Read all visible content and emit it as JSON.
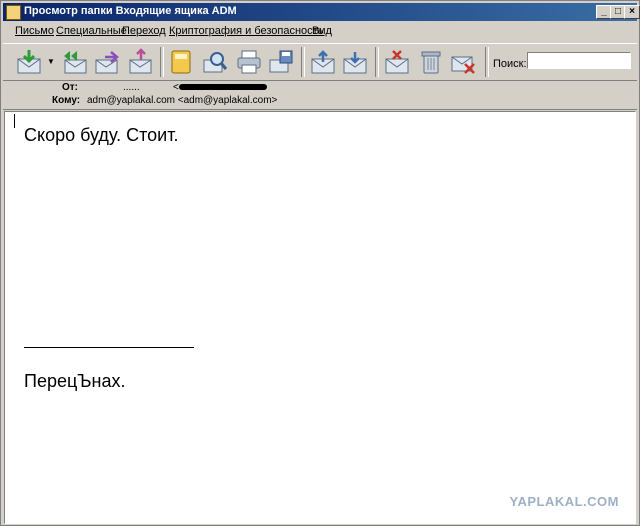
{
  "window": {
    "title": "Просмотр папки Входящие ящика ADM",
    "minimize_glyph": "_",
    "maximize_glyph": "□",
    "close_glyph": "×"
  },
  "menu": {
    "items": [
      "Письмо",
      "Специальные",
      "Переход",
      "Криптография и безопасность",
      "Вид"
    ]
  },
  "toolbar": {
    "buttons": [
      {
        "icon": "get-mail-icon"
      },
      {
        "icon": "reply-all-icon"
      },
      {
        "icon": "forward-icon"
      },
      {
        "icon": "redirect-icon"
      },
      {
        "icon": "address-book-icon"
      },
      {
        "icon": "find-icon"
      },
      {
        "icon": "print-icon"
      },
      {
        "icon": "save-icon"
      },
      {
        "icon": "previous-message-icon"
      },
      {
        "icon": "next-message-icon"
      },
      {
        "icon": "mark-junk-icon"
      },
      {
        "icon": "delete-icon"
      },
      {
        "icon": "delete-junk-icon"
      }
    ],
    "search_label": "Поиск:",
    "search_value": ""
  },
  "header": {
    "from_label": "От:",
    "from_name": "......",
    "from_bracket": "<",
    "to_label": "Кому:",
    "to_value": "adm@yaplakal.com <adm@yaplakal.com>"
  },
  "message": {
    "line1": "Скоро буду. Стоит.",
    "signature": "ПерецЪнах."
  },
  "watermark": "YAPLAKAL.COM",
  "colors": {
    "titlebar_start": "#0a246a",
    "titlebar_end": "#3a6ea5",
    "chrome": "#d4d0c8",
    "envelope": "#dfe6ee",
    "accent_green": "#2e9a3a",
    "accent_red": "#c8352b"
  }
}
